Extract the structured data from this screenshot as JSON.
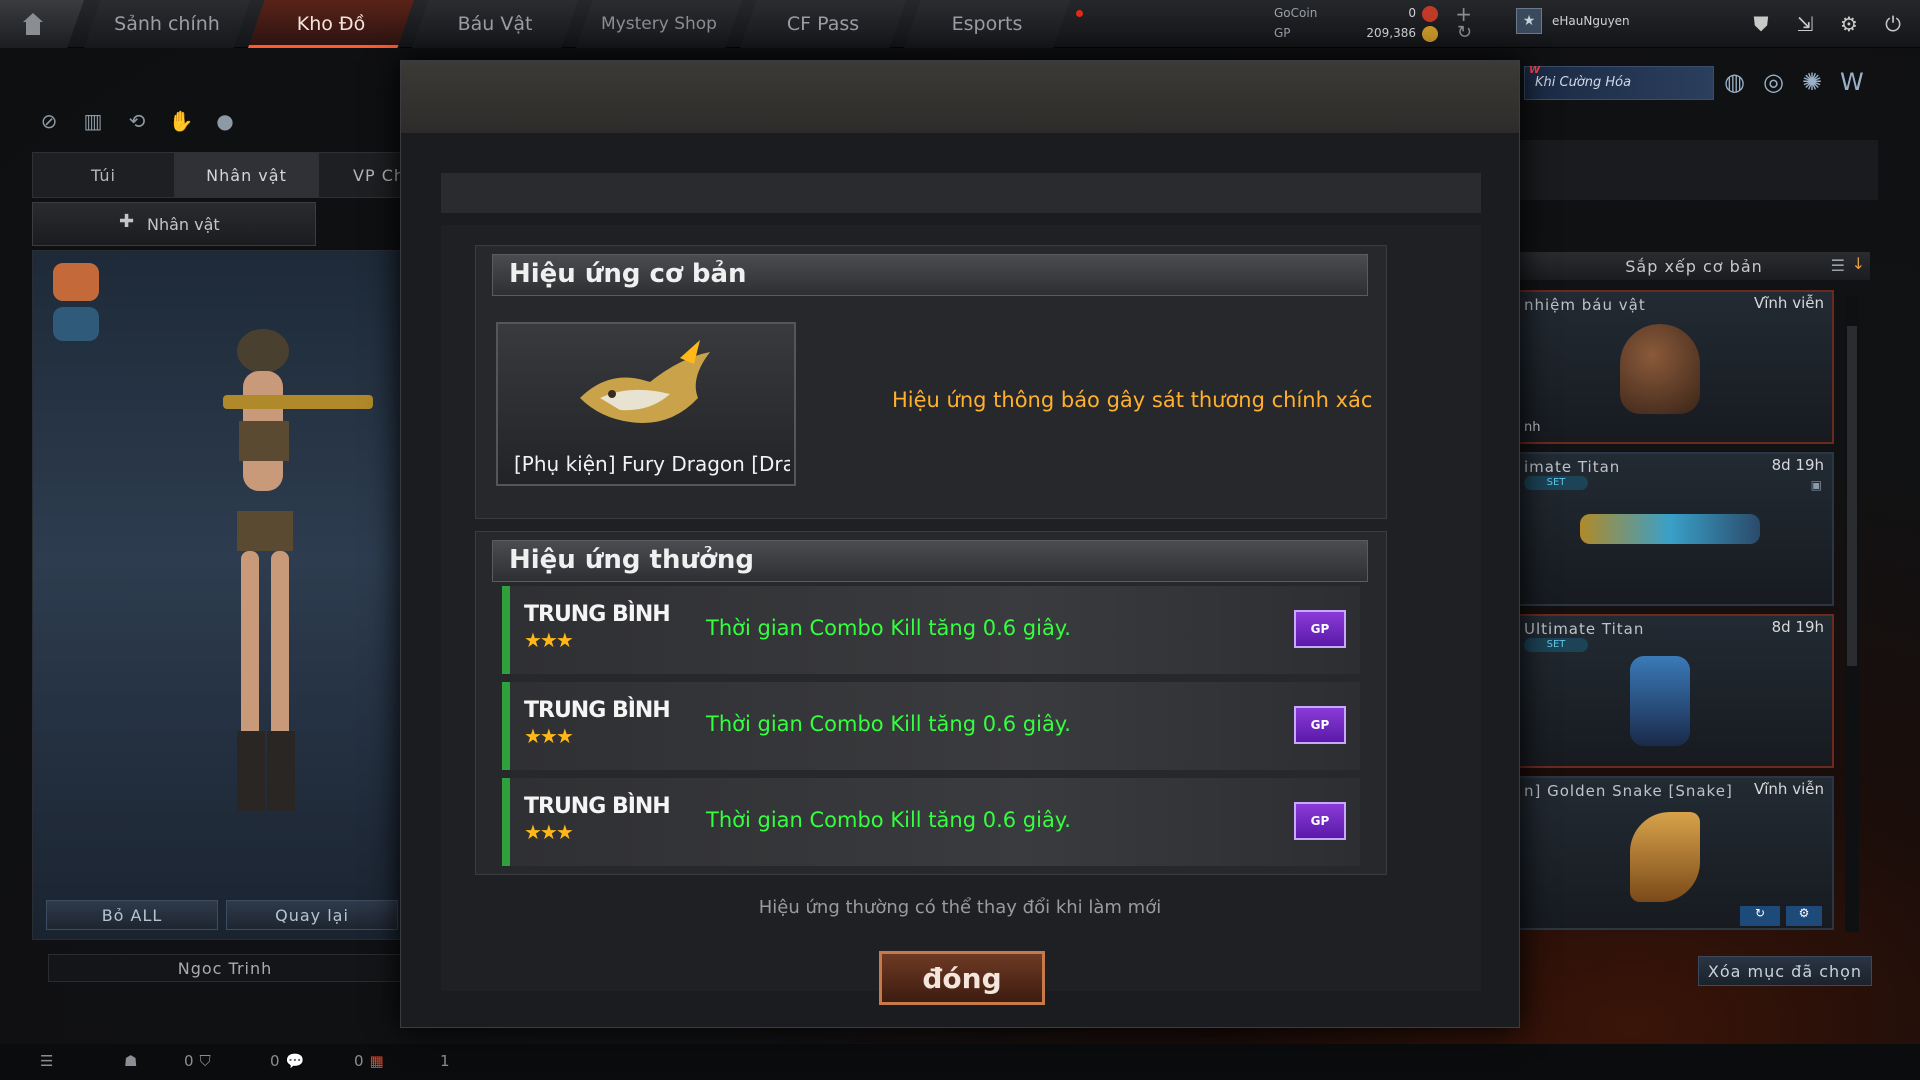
{
  "topbar": {
    "tabs": [
      "Sảnh chính",
      "Kho Đồ",
      "Báu Vật",
      "Mystery Shop",
      "CF Pass",
      "Esports"
    ],
    "active_tab": "Kho Đồ",
    "gocoin_label": "GoCoin",
    "gocoin_value": "0",
    "gp_label": "GP",
    "gp_value": "209,386",
    "username": "eHauNguyen"
  },
  "left": {
    "tabs": [
      "Túi",
      "Nhân vật",
      "VP Chức"
    ],
    "subtab": "Nhân vật",
    "remove_all": "Bỏ ALL",
    "back": "Quay lại",
    "character_name": "Ngoc Trinh"
  },
  "right": {
    "promo": "Khi Cường Hóa",
    "promo_badge": "W",
    "sort_label": "Sắp xếp cơ bản",
    "cards": [
      {
        "name": "nhiệm báu vật",
        "time": "Vĩnh viễn",
        "set": false,
        "extra": "nh"
      },
      {
        "name": "imate Titan",
        "time": "8d 19h",
        "set": true
      },
      {
        "name": "Ultimate Titan",
        "time": "8d 19h",
        "set": true
      },
      {
        "name": "n] Golden Snake [Snake]",
        "time": "Vĩnh viễn",
        "set": false
      }
    ],
    "set_label": "SET",
    "delete_selected": "Xóa mục đã chọn"
  },
  "modal": {
    "basic_title": "Hiệu ứng cơ bản",
    "item_name": "[Phụ kiện] Fury Dragon [Dra",
    "basic_effect": "Hiệu ứng thông báo gây sát thương chính xác",
    "bonus_title": "Hiệu ứng thưởng",
    "rows": [
      {
        "rank": "TRUNG BÌNH",
        "stars": "★★★",
        "text": "Thời gian Combo Kill tăng 0.6 giây."
      },
      {
        "rank": "TRUNG BÌNH",
        "stars": "★★★",
        "text": "Thời gian Combo Kill tăng 0.6 giây."
      },
      {
        "rank": "TRUNG BÌNH",
        "stars": "★★★",
        "text": "Thời gian Combo Kill tăng 0.6 giây."
      }
    ],
    "gp_icon_label": "GP",
    "note": "Hiệu ứng thường có thể thay đổi khi làm mới",
    "close_button": "đóng"
  },
  "bottombar": {
    "count1": "0",
    "count2": "0",
    "count3": "0",
    "count4": "1"
  }
}
